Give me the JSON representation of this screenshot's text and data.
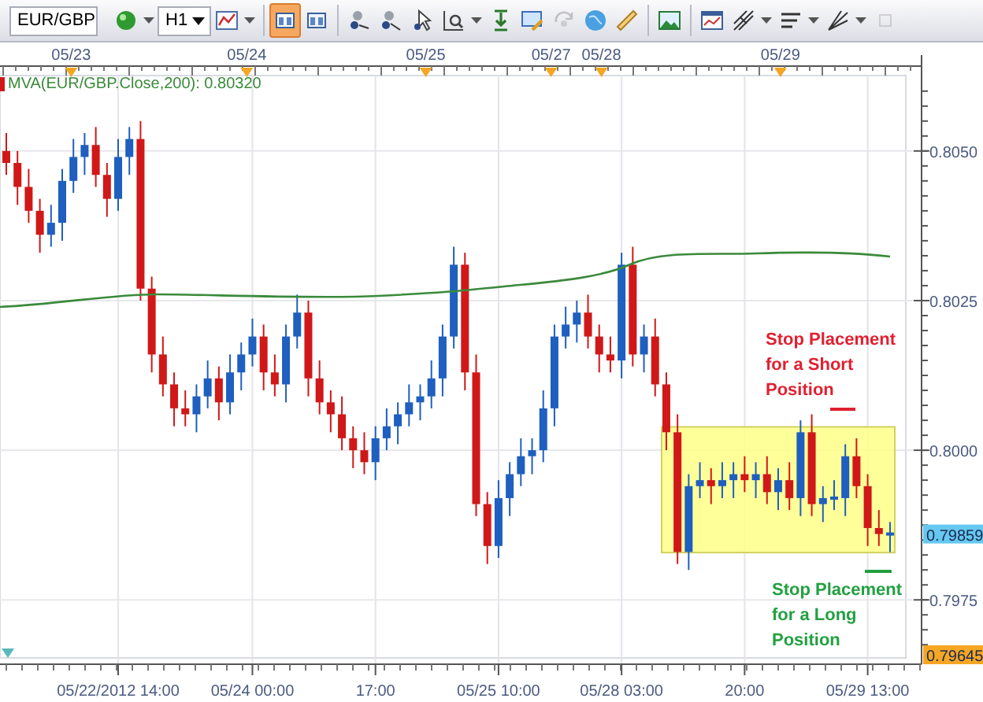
{
  "toolbar": {
    "symbol": "EUR/GBP",
    "timeframe": "H1",
    "tools": [
      {
        "selected": false,
        "menu": true,
        "disabled": false
      },
      {
        "selected": false,
        "menu": true,
        "disabled": false
      },
      {
        "selected": true,
        "menu": false,
        "disabled": false
      },
      {
        "selected": false,
        "menu": false,
        "disabled": false
      },
      {
        "selected": false,
        "menu": false,
        "disabled": false
      },
      {
        "selected": false,
        "menu": false,
        "disabled": false
      },
      {
        "selected": false,
        "menu": false,
        "disabled": false
      },
      {
        "selected": false,
        "menu": true,
        "disabled": false
      },
      {
        "selected": false,
        "menu": false,
        "disabled": false
      },
      {
        "selected": false,
        "menu": false,
        "disabled": false
      },
      {
        "selected": false,
        "menu": false,
        "disabled": true
      },
      {
        "selected": false,
        "menu": false,
        "disabled": false
      },
      {
        "selected": false,
        "menu": false,
        "disabled": false
      },
      {
        "selected": false,
        "menu": false,
        "disabled": false
      },
      {
        "selected": false,
        "menu": false,
        "disabled": false
      },
      {
        "selected": false,
        "menu": true,
        "disabled": false
      },
      {
        "selected": false,
        "menu": true,
        "disabled": false
      },
      {
        "selected": false,
        "menu": true,
        "disabled": false
      },
      {
        "selected": false,
        "menu": false,
        "disabled": true
      }
    ]
  },
  "chart": {
    "indicator_label": "MVA(EUR/GBP.Close,200): 0.80320",
    "top_dates": [
      {
        "label": "05/23"
      },
      {
        "label": "05/24"
      },
      {
        "label": "05/25"
      },
      {
        "label": "05/27"
      },
      {
        "label": "05/28"
      },
      {
        "label": "05/29"
      }
    ],
    "price_badges": [
      {
        "label": "0.79859",
        "color": "#66c8f0"
      },
      {
        "label": "0.79645",
        "color": "#f5a623"
      }
    ],
    "notes": [
      {
        "text": "Stop Placement for a Short Position",
        "color": "#e02030"
      },
      {
        "text": "Stop Placement for a Long Position",
        "color": "#22a040"
      }
    ],
    "chart_data": {
      "type": "candlestick",
      "grid": true,
      "categories": [
        null,
        null,
        null,
        null,
        null,
        null,
        null,
        null,
        null,
        null,
        "05/22/2012 14:00",
        null,
        null,
        null,
        null,
        null,
        null,
        null,
        null,
        null,
        null,
        null,
        "05/24 00:00",
        null,
        null,
        null,
        null,
        null,
        null,
        null,
        null,
        null,
        null,
        "17:00",
        null,
        null,
        null,
        null,
        null,
        null,
        null,
        null,
        null,
        null,
        "05/25 10:00",
        null,
        null,
        null,
        null,
        null,
        null,
        null,
        null,
        null,
        null,
        "05/28 03:00",
        null,
        null,
        null,
        null,
        null,
        null,
        null,
        null,
        null,
        null,
        "20:00",
        null,
        null,
        null,
        null,
        null,
        null,
        null,
        null,
        null,
        null,
        "05/29 13:00",
        null,
        null
      ],
      "ylim": [
        0.79653,
        0.80626
      ],
      "yticks": [
        {
          "value": 0.805,
          "label": "0.8050"
        },
        {
          "value": 0.8025,
          "label": "0.8025"
        },
        {
          "value": 0.8,
          "label": "0.8000"
        },
        {
          "value": 0.7975,
          "label": "0.7975"
        }
      ],
      "ohlc": [
        [
          0.805,
          0.8053,
          0.8046,
          0.8048
        ],
        [
          0.8048,
          0.805,
          0.8041,
          0.8044
        ],
        [
          0.8044,
          0.8047,
          0.8038,
          0.804
        ],
        [
          0.804,
          0.8042,
          0.8033,
          0.8036
        ],
        [
          0.8036,
          0.8041,
          0.8034,
          0.8038
        ],
        [
          0.8038,
          0.8047,
          0.8035,
          0.8045
        ],
        [
          0.8045,
          0.8052,
          0.8043,
          0.8049
        ],
        [
          0.8049,
          0.8053,
          0.8046,
          0.8051
        ],
        [
          0.8051,
          0.8054,
          0.8044,
          0.8046
        ],
        [
          0.8046,
          0.8048,
          0.8039,
          0.8042
        ],
        [
          0.8042,
          0.8052,
          0.804,
          0.8049
        ],
        [
          0.8049,
          0.8054,
          0.8046,
          0.8052
        ],
        [
          0.8052,
          0.8055,
          0.8025,
          0.8027
        ],
        [
          0.8027,
          0.8029,
          0.8013,
          0.8016
        ],
        [
          0.8016,
          0.8019,
          0.8009,
          0.8011
        ],
        [
          0.8011,
          0.8013,
          0.8004,
          0.8007
        ],
        [
          0.8007,
          0.801,
          0.8004,
          0.8006
        ],
        [
          0.8006,
          0.8011,
          0.8003,
          0.8009
        ],
        [
          0.8009,
          0.8015,
          0.8007,
          0.8012
        ],
        [
          0.8012,
          0.8014,
          0.8005,
          0.8008
        ],
        [
          0.8008,
          0.8016,
          0.8006,
          0.8013
        ],
        [
          0.8013,
          0.8018,
          0.801,
          0.8016
        ],
        [
          0.8016,
          0.8022,
          0.8014,
          0.8019
        ],
        [
          0.8019,
          0.8021,
          0.801,
          0.8013
        ],
        [
          0.8013,
          0.8016,
          0.8009,
          0.8011
        ],
        [
          0.8011,
          0.8021,
          0.8008,
          0.8019
        ],
        [
          0.8019,
          0.8026,
          0.8017,
          0.8023
        ],
        [
          0.8023,
          0.8025,
          0.8009,
          0.8012
        ],
        [
          0.8012,
          0.8015,
          0.8006,
          0.8008
        ],
        [
          0.8008,
          0.801,
          0.8003,
          0.8006
        ],
        [
          0.8006,
          0.8009,
          0.8,
          0.8002
        ],
        [
          0.8002,
          0.8004,
          0.7997,
          0.8
        ],
        [
          0.8,
          0.8003,
          0.7996,
          0.7998
        ],
        [
          0.7998,
          0.8004,
          0.7995,
          0.8002
        ],
        [
          0.8002,
          0.8007,
          0.8,
          0.8004
        ],
        [
          0.8004,
          0.8008,
          0.8001,
          0.8006
        ],
        [
          0.8006,
          0.8011,
          0.8004,
          0.8008
        ],
        [
          0.8008,
          0.8011,
          0.8005,
          0.8009
        ],
        [
          0.8009,
          0.8015,
          0.8007,
          0.8012
        ],
        [
          0.8012,
          0.8021,
          0.8009,
          0.8019
        ],
        [
          0.8019,
          0.8034,
          0.8017,
          0.8031
        ],
        [
          0.8031,
          0.8033,
          0.801,
          0.8013
        ],
        [
          0.8013,
          0.8016,
          0.7989,
          0.7991
        ],
        [
          0.7991,
          0.7993,
          0.7981,
          0.7984
        ],
        [
          0.7984,
          0.7995,
          0.7982,
          0.7992
        ],
        [
          0.7992,
          0.7998,
          0.7989,
          0.7996
        ],
        [
          0.7996,
          0.8002,
          0.7994,
          0.7999
        ],
        [
          0.7999,
          0.8002,
          0.7996,
          0.8
        ],
        [
          0.8,
          0.801,
          0.7998,
          0.8007
        ],
        [
          0.8007,
          0.8021,
          0.8004,
          0.8019
        ],
        [
          0.8019,
          0.8024,
          0.8017,
          0.8021
        ],
        [
          0.8021,
          0.8025,
          0.8018,
          0.8023
        ],
        [
          0.8023,
          0.8026,
          0.8017,
          0.8019
        ],
        [
          0.8019,
          0.8021,
          0.8013,
          0.8016
        ],
        [
          0.8016,
          0.8019,
          0.8013,
          0.8015
        ],
        [
          0.8015,
          0.8033,
          0.8012,
          0.8031
        ],
        [
          0.8031,
          0.8034,
          0.8014,
          0.8016
        ],
        [
          0.8016,
          0.8021,
          0.8013,
          0.8019
        ],
        [
          0.8019,
          0.8022,
          0.8009,
          0.8011
        ],
        [
          0.8011,
          0.8013,
          0.8,
          0.8003
        ],
        [
          0.8003,
          0.8006,
          0.7981,
          0.7983
        ],
        [
          0.7983,
          0.7996,
          0.798,
          0.7994
        ],
        [
          0.7994,
          0.7998,
          0.7992,
          0.7995
        ],
        [
          0.7995,
          0.7997,
          0.7991,
          0.7994
        ],
        [
          0.7994,
          0.7998,
          0.7992,
          0.7995
        ],
        [
          0.7995,
          0.7998,
          0.7992,
          0.7996
        ],
        [
          0.7996,
          0.7999,
          0.7993,
          0.7995
        ],
        [
          0.7995,
          0.7998,
          0.7992,
          0.7996
        ],
        [
          0.7996,
          0.7999,
          0.7991,
          0.7993
        ],
        [
          0.7993,
          0.7997,
          0.799,
          0.7995
        ],
        [
          0.7995,
          0.7998,
          0.799,
          0.7992
        ],
        [
          0.7992,
          0.8005,
          0.7989,
          0.8003
        ],
        [
          0.8003,
          0.8006,
          0.7989,
          0.7991
        ],
        [
          0.7991,
          0.7994,
          0.7988,
          0.7992
        ],
        [
          0.7992,
          0.7995,
          0.799,
          0.7992
        ],
        [
          0.7992,
          0.8001,
          0.7989,
          0.7999
        ],
        [
          0.7999,
          0.8002,
          0.7992,
          0.7994
        ],
        [
          0.7994,
          0.7996,
          0.7984,
          0.7987
        ],
        [
          0.7987,
          0.799,
          0.7984,
          0.7986
        ],
        [
          0.7986,
          0.7988,
          0.7983,
          0.7986
        ]
      ]
    }
  }
}
